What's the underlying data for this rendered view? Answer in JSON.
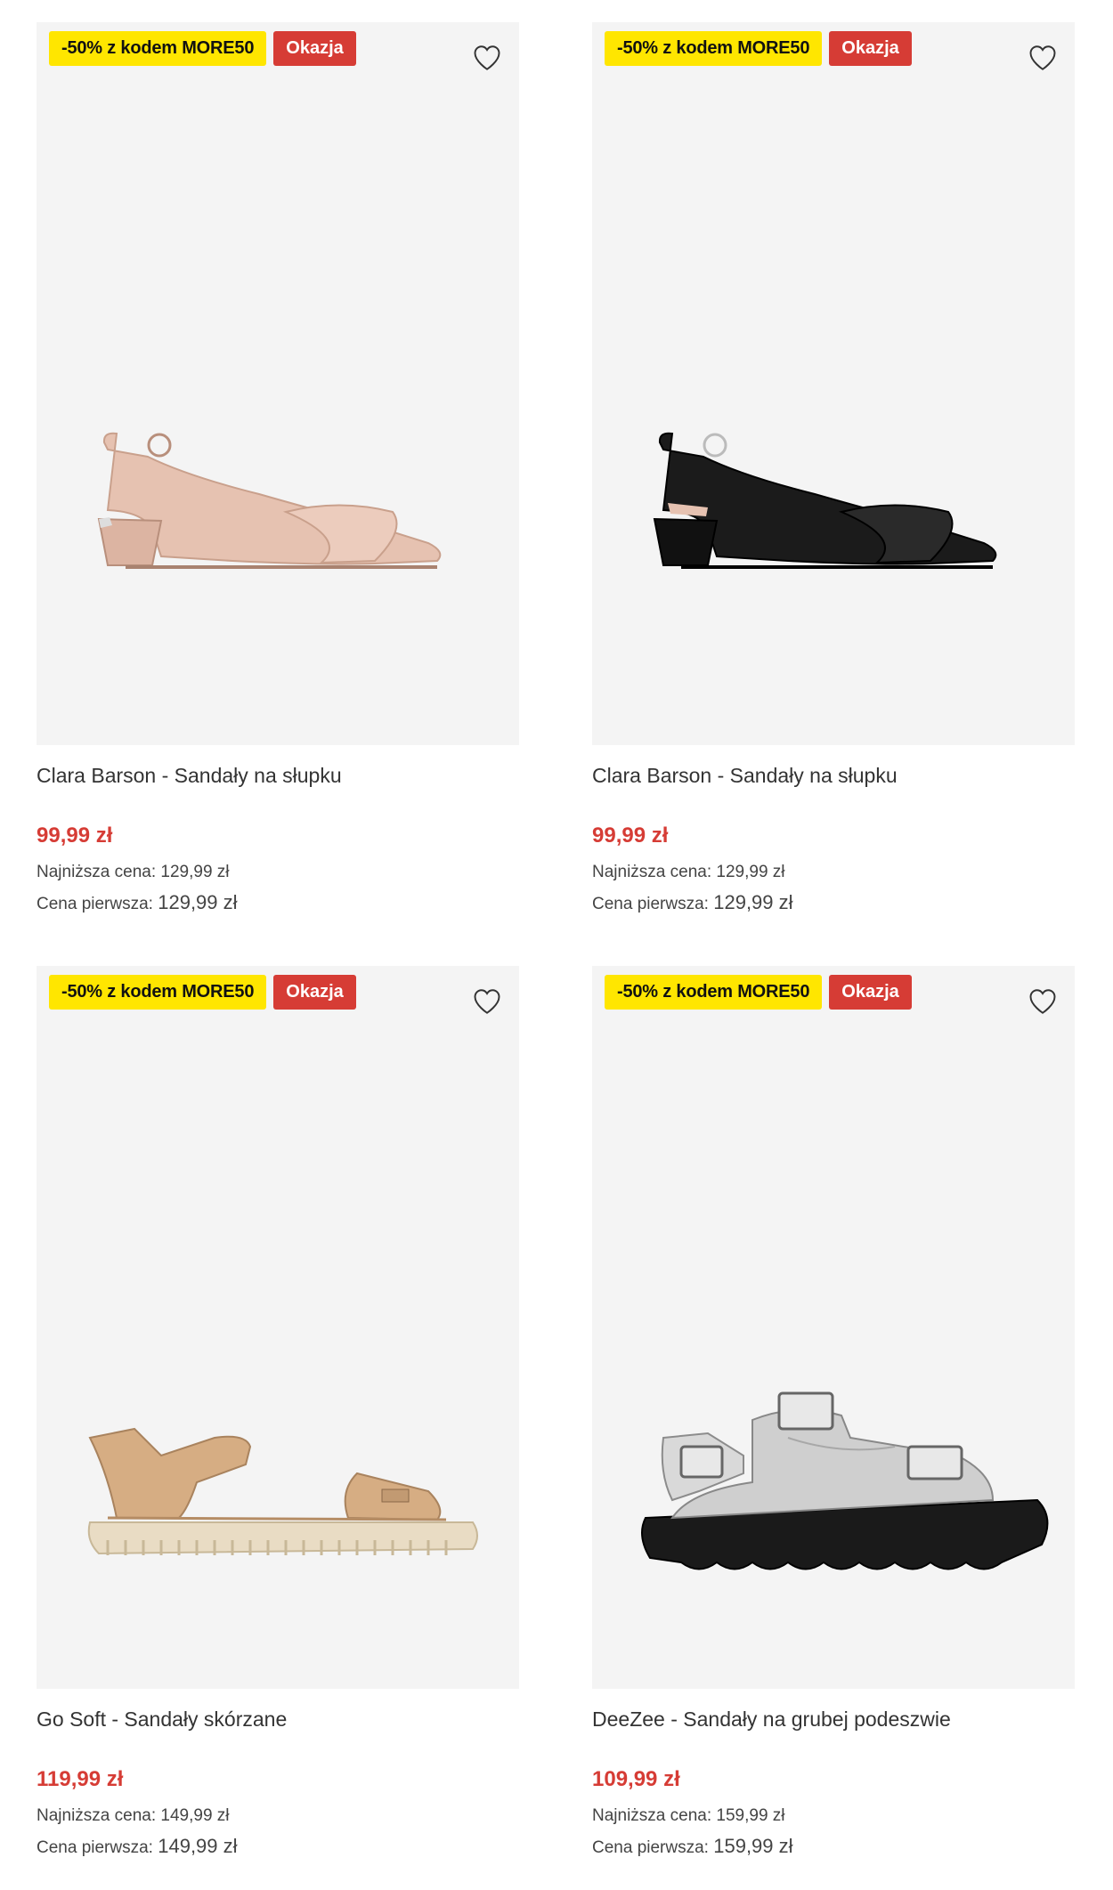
{
  "products": [
    {
      "promo_badge": "-50% z kodem MORE50",
      "deal_badge": "Okazja",
      "name": "Clara Barson - Sandały na słupku",
      "price": "99,99 zł",
      "lowest_label": "Najniższa cena:",
      "lowest_value": "129,99 zł",
      "first_label": "Cena pierwsza:",
      "first_value": "129,99 zł"
    },
    {
      "promo_badge": "-50% z kodem MORE50",
      "deal_badge": "Okazja",
      "name": "Clara Barson - Sandały na słupku",
      "price": "99,99 zł",
      "lowest_label": "Najniższa cena:",
      "lowest_value": "129,99 zł",
      "first_label": "Cena pierwsza:",
      "first_value": "129,99 zł"
    },
    {
      "promo_badge": "-50% z kodem MORE50",
      "deal_badge": "Okazja",
      "name": "Go Soft - Sandały skórzane",
      "price": "119,99 zł",
      "lowest_label": "Najniższa cena:",
      "lowest_value": "149,99 zł",
      "first_label": "Cena pierwsza:",
      "first_value": "149,99 zł"
    },
    {
      "promo_badge": "-50% z kodem MORE50",
      "deal_badge": "Okazja",
      "name": "DeeZee - Sandały na grubej podeszwie",
      "price": "109,99 zł",
      "lowest_label": "Najniższa cena:",
      "lowest_value": "159,99 zł",
      "first_label": "Cena pierwsza:",
      "first_value": "159,99 zł"
    }
  ],
  "colors": {
    "promo": "#ffe600",
    "deal": "#d63c35",
    "price": "#d63c35",
    "image_bg": "#f4f4f4"
  },
  "icons": {
    "wishlist": "heart-outline-icon"
  }
}
